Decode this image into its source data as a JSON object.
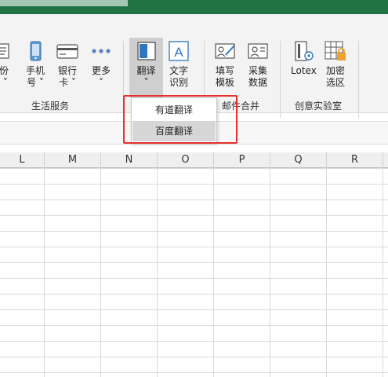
{
  "ribbon": {
    "buttons": {
      "fen": {
        "lines": [
          "身份",
          "证 ˅"
        ]
      },
      "shouji": {
        "lines": [
          "手机",
          "号 ˅"
        ]
      },
      "yinhangka": {
        "lines": [
          "银行",
          "卡 ˅"
        ]
      },
      "gengduo": {
        "lines": [
          "更多",
          "˅"
        ]
      },
      "fanyi": {
        "lines": [
          "翻译",
          "˅"
        ]
      },
      "wenzishibie": {
        "lines": [
          "文字",
          "识别"
        ]
      },
      "tianxiemuban": {
        "lines": [
          "填写",
          "模板"
        ]
      },
      "caijishuju": {
        "lines": [
          "采集",
          "数据"
        ]
      },
      "lotex": {
        "lines": [
          "Lotex",
          ""
        ]
      },
      "jiamixuanqu": {
        "lines": [
          "加密",
          "选区"
        ]
      }
    },
    "groups": {
      "shenghuo": "生活服务",
      "youjian": "邮件合并",
      "chuangyi": "创意实验室"
    }
  },
  "dropdown": {
    "items": [
      "有道翻译",
      "百度翻译"
    ],
    "highlighted_index": 1
  },
  "grid": {
    "columns": [
      "L",
      "M",
      "N",
      "O",
      "P",
      "Q",
      "R"
    ]
  },
  "colors": {
    "titlebar": "#217346",
    "highlight_box": "#e8312f",
    "selected_item": "#d6d6d6"
  }
}
